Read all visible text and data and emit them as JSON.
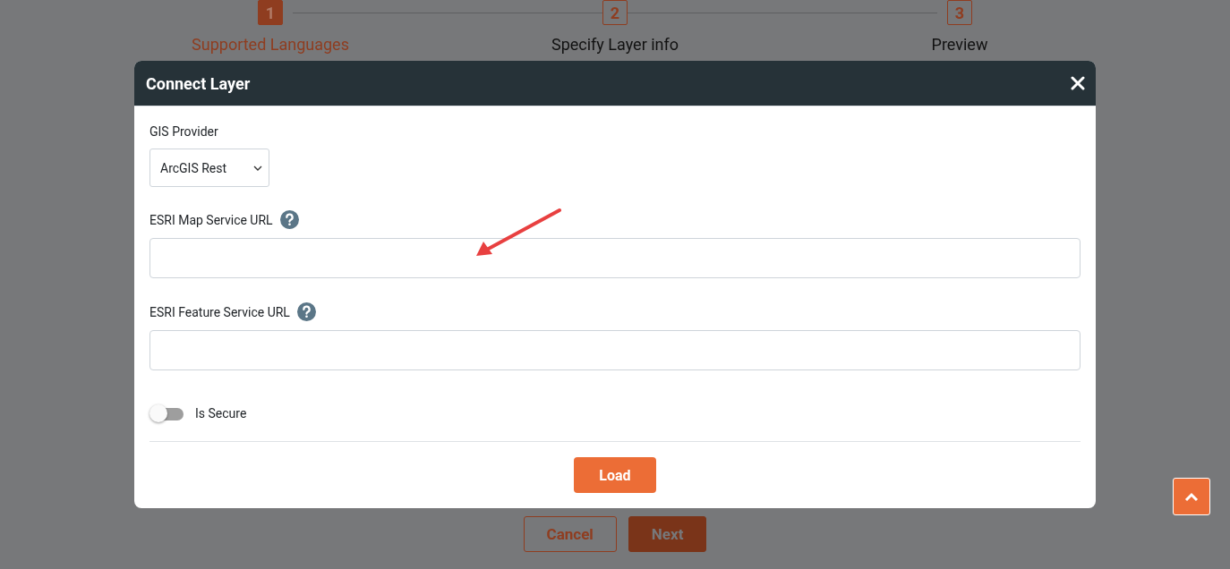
{
  "stepper": [
    {
      "number": "1",
      "label": "Supported Languages",
      "selected": true
    },
    {
      "number": "2",
      "label": "Specify Layer info",
      "selected": false
    },
    {
      "number": "3",
      "label": "Preview",
      "selected": false
    }
  ],
  "footer_buttons": [
    {
      "label": "Cancel",
      "kind": "outline"
    },
    {
      "label": "Next",
      "kind": "filled"
    }
  ],
  "dialog": {
    "title": "Connect Layer",
    "provider": {
      "label": "GIS Provider",
      "value": "ArcGIS Rest"
    },
    "fields": [
      {
        "label": "ESRI Map Service URL"
      },
      {
        "label": "ESRI Feature Service URL"
      }
    ],
    "toggle": {
      "label": "Is Secure",
      "on": false
    },
    "button": "Load"
  }
}
